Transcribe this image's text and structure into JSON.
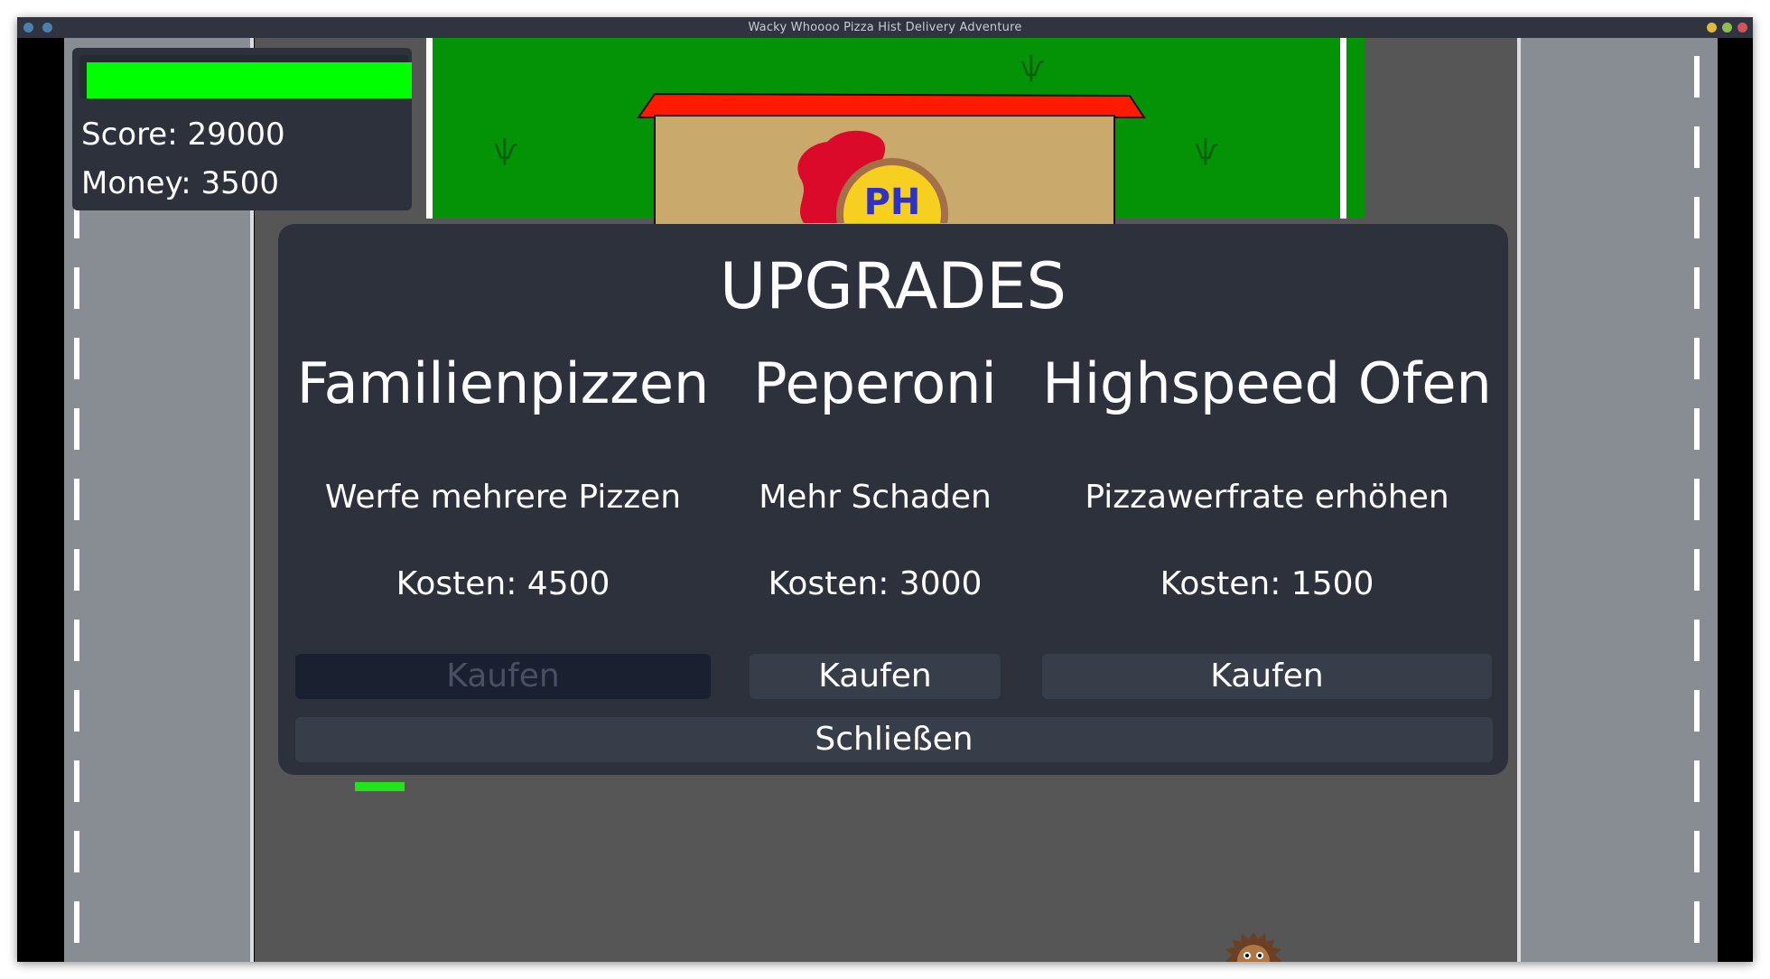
{
  "window": {
    "title": "Wacky Whoooo Pizza Hist Delivery Adventure"
  },
  "hud": {
    "health_fraction": 1.0,
    "health_color": "#00ff00",
    "score_text": "Score: 29000",
    "money_text": "Money: 3500"
  },
  "building": {
    "logo_text": "PH",
    "roof_color": "#ff1a00"
  },
  "upgrades": {
    "title": "UPGRADES",
    "items": [
      {
        "name": "Familienpizzen",
        "description": "Werfe mehrere Pizzen",
        "cost_text": "Kosten: 4500",
        "button_label": "Kaufen",
        "enabled": false
      },
      {
        "name": "Peperoni",
        "description": "Mehr Schaden",
        "cost_text": "Kosten: 3000",
        "button_label": "Kaufen",
        "enabled": true
      },
      {
        "name": "Highspeed Ofen",
        "description": "Pizzawerfrate erhöhen",
        "cost_text": "Kosten: 1500",
        "button_label": "Kaufen",
        "enabled": true
      }
    ],
    "close_label": "Schließen"
  },
  "icons": {
    "enemy": "hedgehog-enemy-icon",
    "player_marker": "green-bar-marker"
  }
}
